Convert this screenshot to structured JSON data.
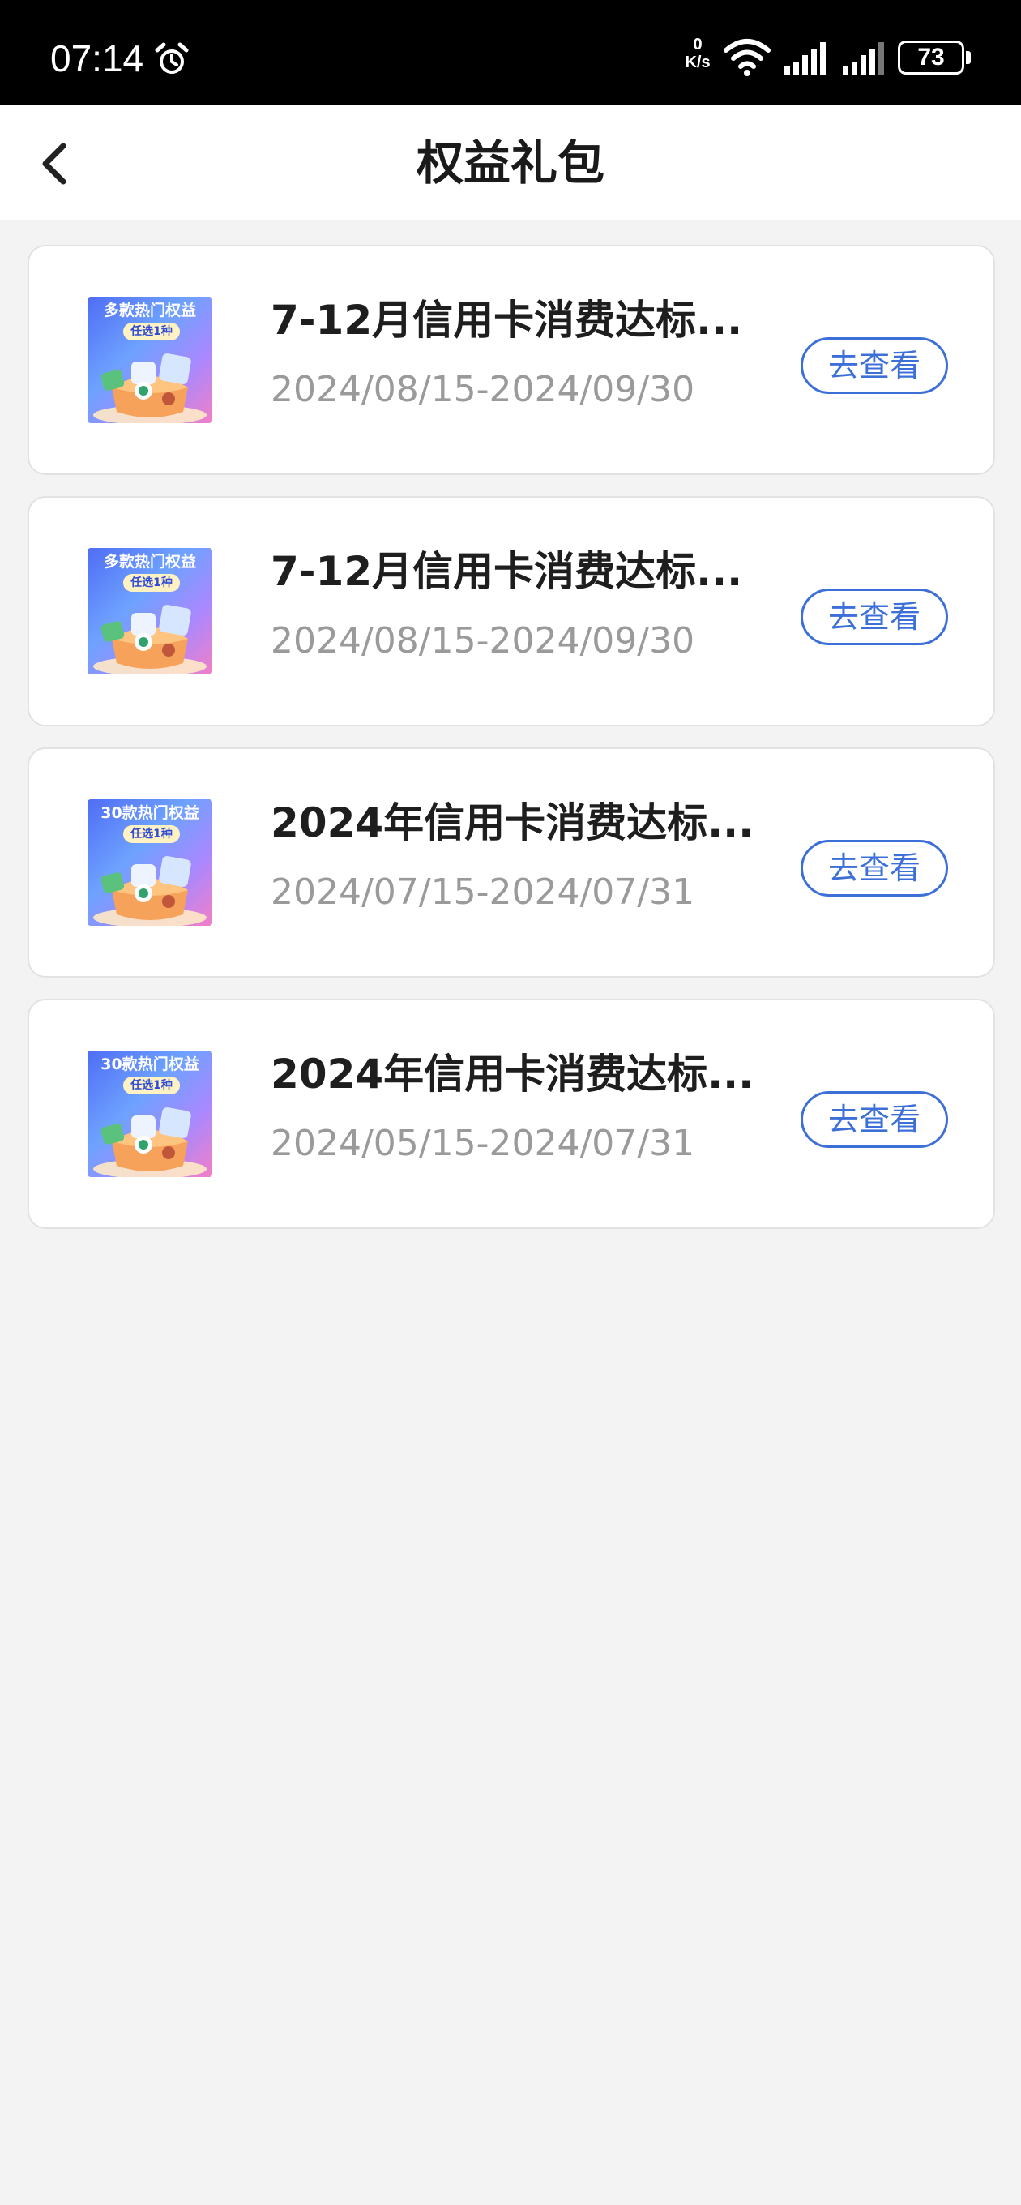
{
  "status_bar": {
    "time": "07:14",
    "net_speed_value": "0",
    "net_speed_unit": "K/s",
    "battery": "73",
    "icons": [
      "alarm-icon",
      "wifi-icon",
      "signal-icon",
      "signal-icon",
      "battery-icon"
    ]
  },
  "header": {
    "title": "权益礼包",
    "back_icon": "chevron-left-icon"
  },
  "items": [
    {
      "thumb_title": "多款热门权益",
      "thumb_pill": "任选1种",
      "title": "7-12月信用卡消费达标...",
      "date": "2024/08/15-2024/09/30",
      "button": "去查看"
    },
    {
      "thumb_title": "多款热门权益",
      "thumb_pill": "任选1种",
      "title": "7-12月信用卡消费达标...",
      "date": "2024/08/15-2024/09/30",
      "button": "去查看"
    },
    {
      "thumb_title": "30款热门权益",
      "thumb_pill": "任选1种",
      "title": "2024年信用卡消费达标...",
      "date": "2024/07/15-2024/07/31",
      "button": "去查看"
    },
    {
      "thumb_title": "30款热门权益",
      "thumb_pill": "任选1种",
      "title": "2024年信用卡消费达标...",
      "date": "2024/05/15-2024/07/31",
      "button": "去查看"
    }
  ],
  "colors": {
    "accent": "#3d6fd8",
    "background": "#f3f3f3",
    "title_text": "#1e1e1e",
    "date_text": "#9a9a9a"
  }
}
